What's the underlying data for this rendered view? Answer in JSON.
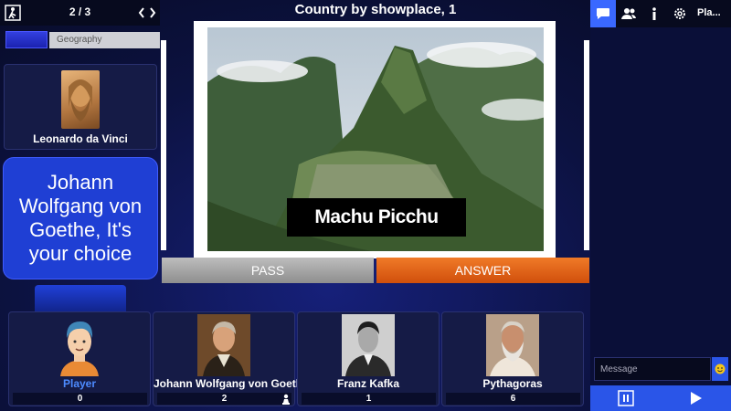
{
  "topbar": {
    "round": "2 / 3"
  },
  "category": {
    "label": "Geography"
  },
  "host": {
    "name": "Leonardo da Vinci"
  },
  "speech": {
    "text": "Johann Wolfgang von Goethe, It's your choice"
  },
  "question": {
    "title": "Country by showplace, 1",
    "caption": "Machu Picchu"
  },
  "buttons": {
    "pass": "PASS",
    "answer": "ANSWER"
  },
  "players": [
    {
      "name": "Player",
      "score": "0",
      "highlight_color": "#4d8bff"
    },
    {
      "name": "Johann Wolfgang von Goethe",
      "score": "2"
    },
    {
      "name": "Franz Kafka",
      "score": "1"
    },
    {
      "name": "Pythagoras",
      "score": "6"
    }
  ],
  "panel": {
    "tab_label": "Pla...",
    "message_placeholder": "Message"
  },
  "colors": {
    "accent_blue": "#3a68ff",
    "answer_orange": "#e8661a",
    "pass_gray": "#a8a8a8"
  }
}
